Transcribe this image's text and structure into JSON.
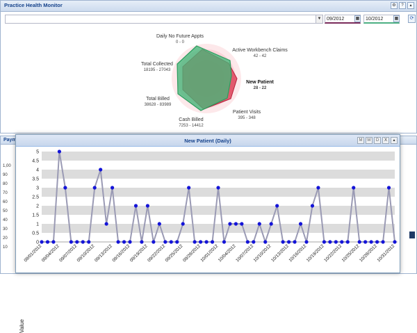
{
  "app": {
    "title": "Practice Health Monitor",
    "tools": [
      "⚙",
      "?",
      "▴"
    ]
  },
  "filters": {
    "dropdown_value": "",
    "date_from": "09/2012",
    "date_to": "10/2012",
    "accent_from": "#7a2a5a",
    "accent_to": "#4caf82"
  },
  "radar": {
    "metrics": [
      {
        "label": "Daily No Future Appts",
        "value": "0 - 0"
      },
      {
        "label": "Active Workbench Claims",
        "value": "42 - 42"
      },
      {
        "label": "New Patient",
        "value": "28 - 22"
      },
      {
        "label": "Patient Visits",
        "value": "395 - 348"
      },
      {
        "label": "Cash Billed",
        "value": "7253 - 14412"
      },
      {
        "label": "Total Billed",
        "value": "38628 - 83989"
      },
      {
        "label": "Total Collected",
        "value": "18195 - 27043"
      }
    ],
    "colors": {
      "series_a": "#44b87a",
      "series_b": "#d9304a"
    }
  },
  "background_panel": {
    "title": "Paym",
    "axis_ticks": [
      "1,00",
      "90",
      "80",
      "70",
      "60",
      "50",
      "40",
      "30",
      "20",
      "10"
    ]
  },
  "window": {
    "title": "New Patient (Daily)",
    "tools": [
      "M",
      "W",
      "D",
      "X",
      "▴"
    ]
  },
  "chart_data": {
    "type": "line",
    "title": "New Patient (Daily)",
    "ylabel": "Value",
    "xlabel": "",
    "ylim": [
      0,
      5
    ],
    "yticks": [
      "0",
      "0.5",
      "1",
      "1.5",
      "2",
      "2.5",
      "3",
      "3.5",
      "4",
      "4.5",
      "5"
    ],
    "x_tick_labels": [
      "09/01/2012",
      "09/04/2012",
      "09/07/2012",
      "09/10/2012",
      "09/13/2012",
      "09/16/2012",
      "09/19/2012",
      "09/22/2012",
      "09/25/2012",
      "09/28/2012",
      "10/01/2012",
      "10/04/2012",
      "10/07/2012",
      "10/10/2012",
      "10/13/2012",
      "10/16/2012",
      "10/19/2012",
      "10/22/2012",
      "10/25/2012",
      "10/28/2012",
      "10/31/2012"
    ],
    "series": [
      {
        "values": [
          0,
          0,
          0,
          5,
          3,
          0,
          0,
          0,
          0,
          3,
          4,
          1,
          3,
          0,
          0,
          0,
          2,
          0,
          2,
          0,
          1,
          0,
          0,
          0,
          1,
          3,
          0,
          0,
          0,
          0,
          3,
          0,
          1,
          1,
          1,
          0,
          0,
          1,
          0,
          1,
          2,
          0,
          0,
          0,
          1,
          0,
          2,
          3,
          0,
          0,
          0,
          0,
          0,
          3,
          0,
          0,
          0,
          0,
          0,
          3,
          0
        ],
        "line_color": "#9a9ab4",
        "marker_color": "#1414d8"
      }
    ],
    "grid": "alternating bands"
  }
}
